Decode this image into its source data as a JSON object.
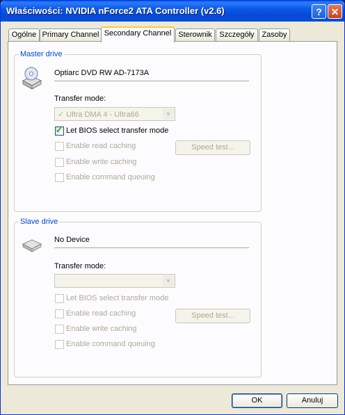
{
  "window": {
    "title": "Właściwości: NVIDIA nForce2 ATA Controller (v2.6)",
    "help_glyph": "?",
    "close_glyph": "✕"
  },
  "tabs": [
    {
      "label": "Ogólne"
    },
    {
      "label": "Primary Channel"
    },
    {
      "label": "Secondary Channel",
      "active": true
    },
    {
      "label": "Sterownik"
    },
    {
      "label": "Szczegóły"
    },
    {
      "label": "Zasoby"
    }
  ],
  "master": {
    "legend": "Master drive",
    "icon": "cd-drive-icon",
    "device": "Optiarc DVD RW AD-7173A",
    "transfer_label": "Transfer mode:",
    "transfer_check": "✓",
    "transfer_value": "Ultra DMA 4 - Ultra66",
    "options": [
      {
        "label": "Let BIOS select transfer mode",
        "checked": true,
        "enabled": true
      },
      {
        "label": "Enable read caching",
        "checked": false,
        "enabled": false
      },
      {
        "label": "Enable write caching",
        "checked": false,
        "enabled": false
      },
      {
        "label": "Enable command queuing",
        "checked": false,
        "enabled": false
      }
    ],
    "speed_test": "Speed test..."
  },
  "slave": {
    "legend": "Slave drive",
    "icon": "empty-drive-icon",
    "device": "No Device",
    "transfer_label": "Transfer mode:",
    "transfer_value": "",
    "options": [
      {
        "label": "Let BIOS select transfer mode",
        "checked": false,
        "enabled": false
      },
      {
        "label": "Enable read caching",
        "checked": false,
        "enabled": false
      },
      {
        "label": "Enable write caching",
        "checked": false,
        "enabled": false
      },
      {
        "label": "Enable command queuing",
        "checked": false,
        "enabled": false
      }
    ],
    "speed_test": "Speed test..."
  },
  "buttons": {
    "ok": "OK",
    "cancel": "Anuluj"
  },
  "colors": {
    "accent": "#0046d5",
    "titlebar": "#0a5ff0",
    "tab_highlight": "#ffc83c"
  }
}
